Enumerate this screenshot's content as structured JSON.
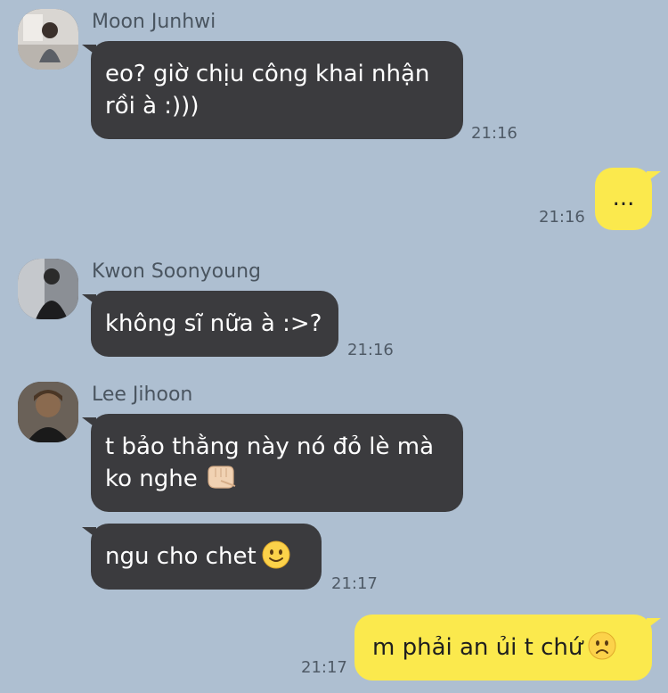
{
  "messages": [
    {
      "sender": "Moon Junhwi",
      "avatar_icon": "profile-photo-avatar",
      "lines": [
        "eo? giờ chịu công khai nhận",
        "rồi à :)))"
      ],
      "time": "21:16"
    },
    {
      "sender": "me",
      "lines": [
        "..."
      ],
      "time": "21:16"
    },
    {
      "sender": "Kwon Soonyoung",
      "avatar_icon": "profile-photo-avatar",
      "lines": [
        "không sĩ nữa à :>?"
      ],
      "time": "21:16"
    },
    {
      "sender": "Lee Jihoon",
      "avatar_icon": "profile-photo-avatar",
      "lines": [
        "t bảo thằng này nó đỏ lè mà",
        "ko nghe"
      ],
      "emoji_icon": "pointing-fist-emoji",
      "time": ""
    },
    {
      "sender": "Lee Jihoon",
      "lines": [
        "ngu cho chet"
      ],
      "emoji_icon": "slight-smile-emoji",
      "time": "21:17"
    },
    {
      "sender": "me",
      "lines": [
        "m phải an ủi t chứ"
      ],
      "emoji_icon": "frowning-face-emoji",
      "time": "21:17"
    }
  ],
  "colors": {
    "background": "#aebfd1",
    "incoming_bubble": "#3b3b3e",
    "outgoing_bubble": "#fbe94d"
  }
}
